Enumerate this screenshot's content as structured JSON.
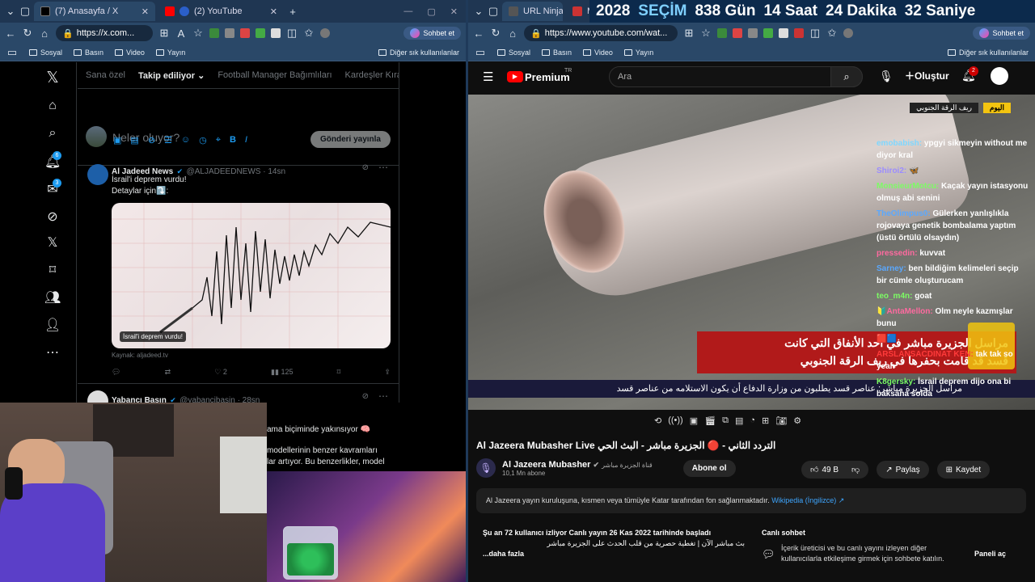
{
  "left_browser": {
    "tabs": [
      {
        "title": "(7) Anasayfa / X",
        "active": true
      },
      {
        "title": "(2) YouTube",
        "active": false
      }
    ],
    "url": "https://x.com...",
    "sohbet_label": "Sohbet et",
    "bookmarks": [
      "Sosyal",
      "Basın",
      "Video",
      "Yayın"
    ],
    "other_bookmarks": "Diğer sık kullanılanlar"
  },
  "right_browser": {
    "tabs": [
      {
        "title": "URL Ninja"
      },
      {
        "title": "M"
      }
    ],
    "url": "https://www.youtube.com/wat...",
    "sohbet_label": "Sohbet et",
    "bookmarks": [
      "Sosyal",
      "Basın",
      "Video",
      "Yayın"
    ],
    "other_bookmarks": "Diğer sık kullanılanlar"
  },
  "countdown": {
    "year": "2028",
    "label": "SEÇİM",
    "days": "838 Gün",
    "hours": "14 Saat",
    "minutes": "24 Dakika",
    "seconds": "32 Saniye"
  },
  "x": {
    "badges": {
      "notifications": "6",
      "messages": "3"
    },
    "tabs": [
      {
        "label": "Sana özel",
        "active": false
      },
      {
        "label": "Takip ediliyor",
        "active": true
      },
      {
        "label": "Football Manager Bağımlıları",
        "active": false
      },
      {
        "label": "Kardeşler Kıraa",
        "active": false
      }
    ],
    "compose_placeholder": "Neler oluyor?",
    "post_button": "Gönderi yayınla",
    "tweet1": {
      "name": "Al Jadeed News",
      "handle": "@ALJADEEDNEWS · 14sn",
      "text1": "İsrail'i deprem vurdu!",
      "text2": "Detaylar için⤵️:",
      "image_caption": "İsrail'i deprem vurdu!",
      "source": "Kaynak: aljadeed.tv",
      "likes": "2",
      "views": "125"
    },
    "tweet2": {
      "name": "Yabancı Basın",
      "handle": "@yabancibasin · 28sn",
      "text1": "ama biçiminde yakınsıyor 🧠",
      "text2": "modellerinin benzer kavramları",
      "text3": "lar artıyor. Bu benzerlikler, model"
    }
  },
  "youtube": {
    "brand": "Premium",
    "brand_sup": "TR",
    "search_placeholder": "Ara",
    "create_label": "Oluştur",
    "notif_count": "2",
    "overlay": {
      "today": "اليوم",
      "region": "ريف الرقة الجنوبي",
      "headline1": "مراسل الجزيرة مباشر في أحد الأنفاق التي كانت",
      "headline2": "قسد قد قامت بحفرها في ريف الرقة الجنوبي",
      "ticker": "مراسل الجزيرة مباشر: عناصر قسد يطلبون من وزارة الدفاع أن يكون    الاستلامه من عناصر قسد"
    },
    "title": "Al Jazeera Mubasher Live التردد الثاني - 🔴 الجزيرة مباشر - البث الحي",
    "channel_name": "Al Jazeera Mubasher",
    "channel_ar": "قناة الجزيرة مباشر",
    "subscribers": "10,1 Mn abone",
    "subscribe": "Abone ol",
    "likes": "49 B",
    "share": "Paylaş",
    "save": "Kaydet",
    "info": "Al Jazeera yayın kuruluşuna, kısmen veya tümüyle Katar tarafından fon sağlanmaktadır.",
    "info_link": "Wikipedia (İngilizce) ↗",
    "watching": "Şu an 72 kullanıcı izliyor  Canlı yayın 26 Kas 2022 tarihinde başladı",
    "desc_line": "بث مباشر الآن | تغطية حصرية من قلب الحدث على الجزيرة مباشر",
    "more": "...daha fazla",
    "live_chat_title": "Canlı sohbet",
    "live_chat_desc": "İçerik üreticisi ve bu canlı yayını izleyen diğer kullanıcılarla etkileşime girmek için sohbete katılın.",
    "open_panel": "Paneli aç",
    "chat": [
      {
        "user": "emobabish:",
        "msg": "ypgyi sikmeyin without me diyor kral",
        "color": "#7fd7ff"
      },
      {
        "user": "Shiroi2:",
        "msg": "🦋",
        "color": "#9b8cff"
      },
      {
        "user": "MonsieurMotcu:",
        "msg": "Kaçak yayın istasyonu olmuş abi senini",
        "color": "#7cfc64"
      },
      {
        "user": "TheOlimpus0:",
        "msg": "Gülerken yanlışlıkla rojovaya genetik bombalama yaptım (üstü örtülü olsaydın)",
        "color": "#5aa8ff"
      },
      {
        "user": "pressedin:",
        "msg": "kuvvat",
        "color": "#ff6aa0"
      },
      {
        "user": "Sarney:",
        "msg": "ben bildiğim kelimeleri seçip bir cümle oluşturucam",
        "color": "#5aa8ff"
      },
      {
        "user": "teo_m4n:",
        "msg": "goat",
        "color": "#7cfc64"
      },
      {
        "user": "🔰AntaMellon:",
        "msg": "Olm neyle kazmışlar bunu",
        "color": "#ff6aa0"
      },
      {
        "user": "🟥🟦",
        "msg": "",
        "color": "#fff"
      },
      {
        "user": "ARSLANSACDINAT KEN:",
        "msg": "tak tak so yeah",
        "color": "#ff3a3a"
      },
      {
        "user": "K8gersky:",
        "msg": "İsrail deprem dijo ona bi baksana solda",
        "color": "#7cfc64"
      }
    ]
  }
}
